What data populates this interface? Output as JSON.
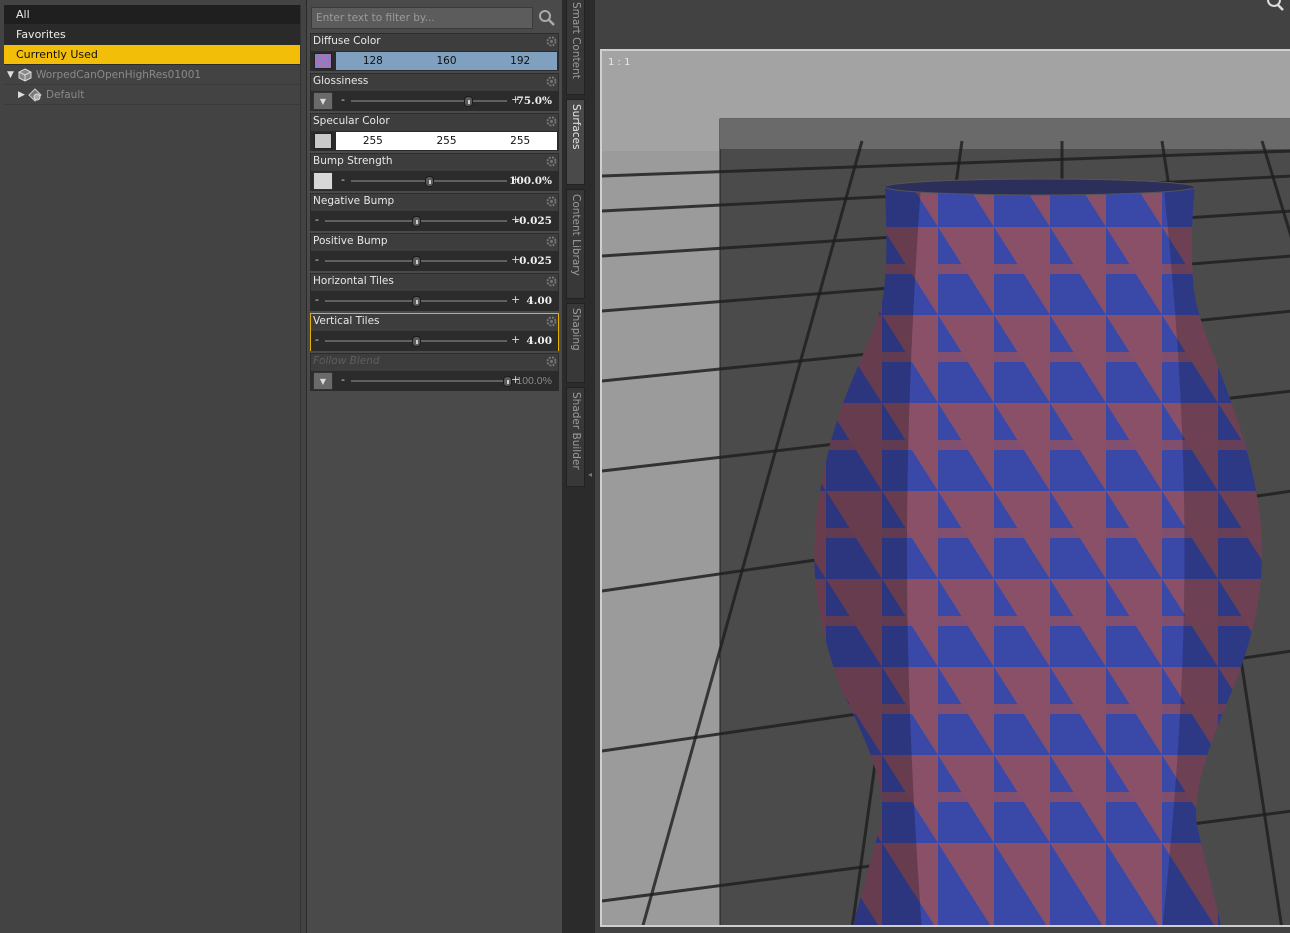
{
  "left_panel": {
    "filters": [
      {
        "label": "All",
        "state": "normal"
      },
      {
        "label": "Favorites",
        "state": "normal"
      },
      {
        "label": "Currently Used",
        "state": "selected"
      }
    ],
    "tree": [
      {
        "label": "WorpedCanOpenHighRes01001",
        "icon": "figure-icon",
        "expanded": true
      },
      {
        "label": "Default",
        "icon": "material-group-icon",
        "expanded": false
      }
    ]
  },
  "surfaces": {
    "search_placeholder": "Enter text to filter by...",
    "properties": [
      {
        "name": "Diffuse Color",
        "type": "color",
        "r": "128",
        "g": "160",
        "b": "192",
        "color": "#80a0c0"
      },
      {
        "name": "Glossiness",
        "type": "slider_map",
        "value": "75.0%",
        "fraction": 0.75
      },
      {
        "name": "Specular Color",
        "type": "color",
        "r": "255",
        "g": "255",
        "b": "255",
        "color": "#ffffff"
      },
      {
        "name": "Bump Strength",
        "type": "slider_map",
        "value": "100.0%",
        "fraction": 0.5
      },
      {
        "name": "Negative Bump",
        "type": "slider",
        "value": "-0.025",
        "fraction": 0.5
      },
      {
        "name": "Positive Bump",
        "type": "slider",
        "value": "0.025",
        "fraction": 0.5
      },
      {
        "name": "Horizontal Tiles",
        "type": "slider",
        "value": "4.00",
        "fraction": 0.5
      },
      {
        "name": "Vertical Tiles",
        "type": "slider",
        "value": "4.00",
        "fraction": 0.5,
        "highlighted": true
      },
      {
        "name": "Follow Blend",
        "type": "slider_map",
        "value": "100.0%",
        "fraction": 1.0,
        "disabled": true
      }
    ]
  },
  "side_tabs": [
    "Smart Content",
    "Surfaces",
    "Content Library",
    "Shaping",
    "Shader Builder"
  ],
  "active_tab": "Surfaces",
  "viewport": {
    "zoom_label": "1 : 1"
  },
  "colors": {
    "accent": "#f3be08",
    "vase_blue": "#3a48a8",
    "vase_red": "#8a5068"
  }
}
